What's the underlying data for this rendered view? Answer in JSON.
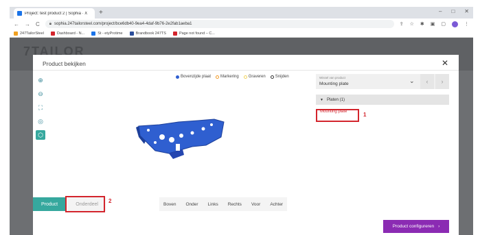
{
  "browser": {
    "tab_title": "Project: test product 2 | Sophia · X",
    "new_tab_symbol": "+",
    "window_controls": [
      "–",
      "□",
      "✕"
    ],
    "url": "sophia.247tailorsteel.com/project/bce6db40-9ea4-4daf-9b76-2e2fab1aeba1",
    "nav": {
      "back": "←",
      "forward": "→",
      "reload": "C"
    },
    "bookmarks": [
      {
        "label": "247TailorSteel",
        "color": "#f0a020"
      },
      {
        "label": "Dashboard - N...",
        "color": "#d3242c"
      },
      {
        "label": "St - etyProtime",
        "color": "#1a73e8"
      },
      {
        "label": "Brandbook 247TS",
        "color": "#2a4d9a"
      },
      {
        "label": "Page not found – C...",
        "color": "#d3242c"
      }
    ]
  },
  "background": {
    "logo_fragment": "7TAILOR"
  },
  "modal": {
    "title": "Product bekijken",
    "close_symbol": "✕",
    "tools": [
      {
        "name": "zoom-in-icon",
        "glyph": "⊕"
      },
      {
        "name": "zoom-out-icon",
        "glyph": "⊖"
      },
      {
        "name": "fit-view-icon",
        "glyph": "⛶"
      },
      {
        "name": "layers-icon",
        "glyph": "◎"
      },
      {
        "name": "cube-icon",
        "glyph": "⬡"
      }
    ],
    "legend": [
      {
        "label": "Bovenzijde plaat",
        "color": "#2f5fd0",
        "style": "dot"
      },
      {
        "label": "Markering",
        "color": "#f29a26",
        "style": "ring"
      },
      {
        "label": "Graveren",
        "color": "#f2d35c",
        "style": "ring"
      },
      {
        "label": "Snijden",
        "color": "#333333",
        "style": "ring"
      }
    ],
    "bottom_tabs": {
      "product": "Product",
      "onderdeel": "Onderdeel"
    },
    "views": [
      "Boven",
      "Onder",
      "Links",
      "Rechts",
      "Voor",
      "Achter"
    ],
    "panel": {
      "select_label": "Wissel van product",
      "select_value": "Mounting plate",
      "chevron": "⌄",
      "prev": "‹",
      "next": "›",
      "group_label": "Platen (1)",
      "item_label": "Mounting plate"
    },
    "annotations": [
      "1",
      "2"
    ],
    "cta": {
      "label": "Product configureren",
      "arrow": "›"
    }
  },
  "colors": {
    "accent_teal": "#36a89e",
    "cta_purple": "#8b2bb3",
    "marker_red": "#d3242c",
    "part_blue": "#2f5fd0"
  }
}
